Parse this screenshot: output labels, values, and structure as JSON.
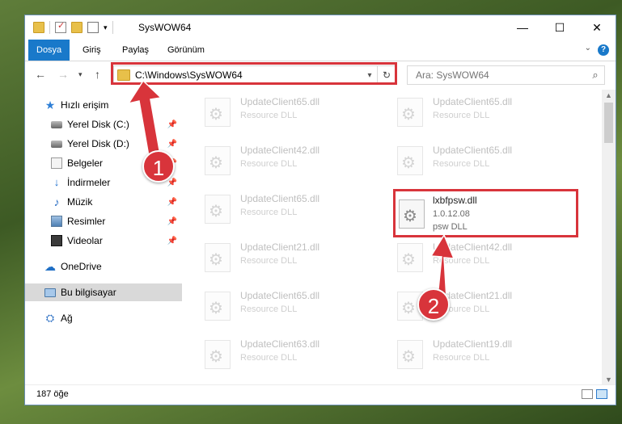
{
  "window": {
    "title": "SysWOW64",
    "caption": {
      "minimize": "—",
      "maximize": "☐",
      "close": "✕"
    }
  },
  "ribbon": {
    "tabs": [
      "Dosya",
      "Giriş",
      "Paylaş",
      "Görünüm"
    ],
    "help": "?"
  },
  "nav": {
    "address": "C:\\Windows\\SysWOW64",
    "search_placeholder": "Ara: SysWOW64"
  },
  "sidebar": {
    "items": [
      {
        "label": "Hızlı erişim",
        "icon": "star-icon"
      },
      {
        "label": "Yerel Disk (C:)",
        "icon": "disk-icon",
        "pinned": true
      },
      {
        "label": "Yerel Disk (D:)",
        "icon": "disk-icon",
        "pinned": true
      },
      {
        "label": "Belgeler",
        "icon": "documents-icon",
        "pinned": true
      },
      {
        "label": "İndirmeler",
        "icon": "download-icon",
        "pinned": true
      },
      {
        "label": "Müzik",
        "icon": "music-icon",
        "pinned": true
      },
      {
        "label": "Resimler",
        "icon": "pictures-icon",
        "pinned": true
      },
      {
        "label": "Videolar",
        "icon": "videos-icon",
        "pinned": true
      },
      {
        "label": "OneDrive",
        "icon": "onedrive-icon"
      },
      {
        "label": "Bu bilgisayar",
        "icon": "computer-icon",
        "selected": true
      },
      {
        "label": "Ağ",
        "icon": "network-icon"
      }
    ]
  },
  "files": [
    {
      "name": "UpdateClient65.dll",
      "type": "Resource DLL"
    },
    {
      "name": "UpdateClient65.dll",
      "type": "Resource DLL"
    },
    {
      "name": "UpdateClient42.dll",
      "type": "Resource DLL"
    },
    {
      "name": "UpdateClient65.dll",
      "type": "Resource DLL"
    },
    {
      "name": "UpdateClient65.dll",
      "type": "Resource DLL"
    },
    {
      "name": "lxbfpsw.dll",
      "version": "1.0.12.08",
      "type": "psw DLL",
      "highlighted": true
    },
    {
      "name": "UpdateClient21.dll",
      "type": "Resource DLL"
    },
    {
      "name": "UpdateClient42.dll",
      "type": "Resource DLL"
    },
    {
      "name": "UpdateClient65.dll",
      "type": "Resource DLL"
    },
    {
      "name": "UpdateClient21.dll",
      "type": "Resource DLL"
    },
    {
      "name": "UpdateClient63.dll",
      "type": "Resource DLL"
    },
    {
      "name": "UpdateClient19.dll",
      "type": "Resource DLL"
    }
  ],
  "status": {
    "count": "187 öğe"
  },
  "annotations": {
    "step1": "1",
    "step2": "2",
    "color": "#d8343b"
  }
}
